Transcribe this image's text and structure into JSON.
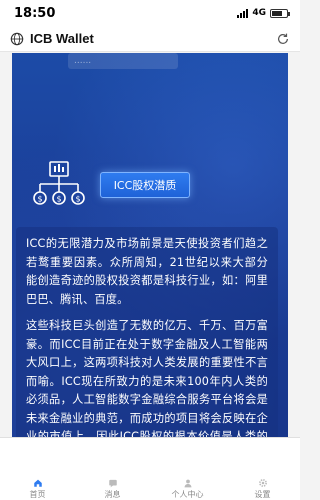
{
  "status": {
    "time": "18:50",
    "network": "4G"
  },
  "header": {
    "title": "ICB Wallet"
  },
  "content": {
    "top_fragment": "......",
    "section_button": "ICC股权潜质",
    "paragraphs": [
      "ICC的无限潜力及市场前景是天使投资者们趋之若鹜重要因素。众所周知，21世纪以来大部分能创造奇迹的股权投资都是科技行业，如：阿里巴巴、腾讯、百度。",
      "这些科技巨头创造了无数的亿万、千万、百万富豪。而ICC目前正在处于数字金融及人工智能两大风口上，这两项科技对人类发展的重要性不言而喻。ICC现在所致力的是未来100年内人类的必须品，人工智能数字金融综合服务平台将会是未来金融业的典范，而成功的项目将会反映在企业的市值上。因此ICC股权的根本价值是人类的发展与金融业的蜕变，这样的股权所能创造的未来无可限量。"
    ]
  },
  "tabbar": {
    "tabs": [
      "首页",
      "消息",
      "个人中心",
      "设置"
    ]
  },
  "colors": {
    "card": "#1b3f99",
    "accent": "#2f7cf0",
    "tab_active": "#2f7cf0"
  }
}
